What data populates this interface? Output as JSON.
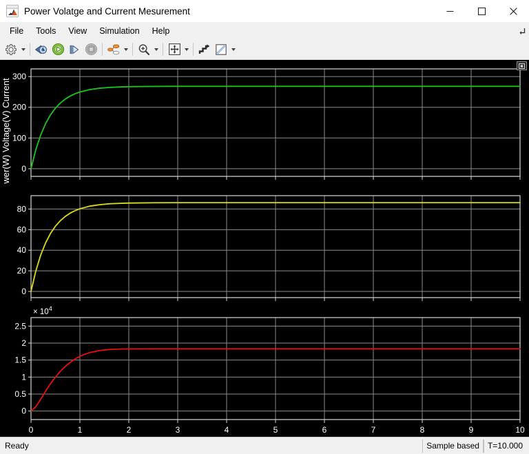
{
  "window": {
    "title": "Power Volatge and Current Mesurement",
    "app_icon": "matlab-scope-icon",
    "minimize_label": "–",
    "maximize_label": "□",
    "close_label": "✕"
  },
  "menu": {
    "items": [
      {
        "label": "File",
        "name": "menu-file"
      },
      {
        "label": "Tools",
        "name": "menu-tools"
      },
      {
        "label": "View",
        "name": "menu-view"
      },
      {
        "label": "Simulation",
        "name": "menu-simulation"
      },
      {
        "label": "Help",
        "name": "menu-help"
      }
    ],
    "overflow_icon": "menu-overflow-arrow-icon"
  },
  "toolbar": {
    "buttons": [
      {
        "name": "configuration-properties-button",
        "icon": "gear-icon",
        "has_caret": true,
        "enabled": true
      },
      {
        "name": "separator-1",
        "icon": "separator",
        "has_caret": false,
        "enabled": true
      },
      {
        "name": "run-back-to-start-button",
        "icon": "rewind-clock-icon",
        "has_caret": false,
        "enabled": true
      },
      {
        "name": "run-button",
        "icon": "play-icon",
        "has_caret": false,
        "enabled": true
      },
      {
        "name": "step-forward-button",
        "icon": "step-forward-icon",
        "has_caret": false,
        "enabled": true
      },
      {
        "name": "stop-button",
        "icon": "stop-icon",
        "has_caret": false,
        "enabled": false
      },
      {
        "name": "separator-2",
        "icon": "separator",
        "has_caret": false,
        "enabled": true
      },
      {
        "name": "signal-selector-button",
        "icon": "signal-selector-icon",
        "has_caret": true,
        "enabled": true
      },
      {
        "name": "separator-3",
        "icon": "separator",
        "has_caret": false,
        "enabled": true
      },
      {
        "name": "zoom-in-button",
        "icon": "magnifier-plus-icon",
        "has_caret": true,
        "enabled": true
      },
      {
        "name": "separator-4",
        "icon": "separator",
        "has_caret": false,
        "enabled": true
      },
      {
        "name": "autoscale-button",
        "icon": "four-arrows-icon",
        "has_caret": true,
        "enabled": true
      },
      {
        "name": "separator-5",
        "icon": "separator",
        "has_caret": false,
        "enabled": true
      },
      {
        "name": "cursor-measurements-button",
        "icon": "staircase-cursor-icon",
        "has_caret": false,
        "enabled": true
      },
      {
        "name": "annotations-button",
        "icon": "pencil-ruler-icon",
        "has_caret": true,
        "enabled": true
      }
    ]
  },
  "scope": {
    "float_button_icon": "expand-arrows-icon",
    "y_axis_label": "wer(W) Voltage(V) Current",
    "background": "#000000",
    "grid_color": "#8c8c8c",
    "axis_color": "#d9d9d9",
    "tick_text_color": "#ffffff"
  },
  "statusbar": {
    "state": "Ready",
    "frame_mode": "Sample based",
    "time": "T=10.000"
  },
  "chart_data": [
    {
      "type": "line",
      "name": "current-plot",
      "title": "",
      "xlabel": "",
      "ylabel": "Current",
      "color": "#1fbe1f",
      "xlim": [
        0,
        10
      ],
      "ylim": [
        -25,
        325
      ],
      "xticks": [
        0,
        1,
        2,
        3,
        4,
        5,
        6,
        7,
        8,
        9,
        10
      ],
      "xticklabels": [
        "",
        "",
        "",
        "",
        "",
        "",
        "",
        "",
        "",
        "",
        ""
      ],
      "yticks": [
        0,
        100,
        200,
        300
      ],
      "yticklabels": [
        "0",
        "100",
        "200",
        "300"
      ],
      "grid": true,
      "steady_state_value": 238,
      "time_constant": 0.32,
      "x": [
        0,
        0.1,
        0.2,
        0.3,
        0.4,
        0.5,
        0.6,
        0.7,
        0.8,
        0.9,
        1.0,
        1.2,
        1.4,
        1.6,
        1.8,
        2.0,
        2.5,
        3.0,
        4.0,
        5.0,
        6.0,
        7.0,
        8.0,
        9.0,
        10.0
      ],
      "y": [
        0,
        62.5,
        110.5,
        147.3,
        175.5,
        197.2,
        213.8,
        226.6,
        236.4,
        244.0,
        249.7,
        257.5,
        262.0,
        264.6,
        266.1,
        267.0,
        268.0,
        268.2,
        268.2,
        268.2,
        268.2,
        268.2,
        268.2,
        268.2,
        268.2
      ]
    },
    {
      "type": "line",
      "name": "voltage-plot",
      "title": "",
      "xlabel": "",
      "ylabel": "Voltage(V)",
      "color": "#d4d424",
      "xlim": [
        0,
        10
      ],
      "ylim": [
        -6,
        93
      ],
      "xticks": [
        0,
        1,
        2,
        3,
        4,
        5,
        6,
        7,
        8,
        9,
        10
      ],
      "xticklabels": [
        "",
        "",
        "",
        "",
        "",
        "",
        "",
        "",
        "",
        "",
        ""
      ],
      "yticks": [
        0,
        20,
        40,
        60,
        80
      ],
      "yticklabels": [
        "0",
        "20",
        "40",
        "60",
        "80"
      ],
      "grid": true,
      "steady_state_value": 76.5,
      "time_constant": 0.32,
      "x": [
        0,
        0.1,
        0.2,
        0.3,
        0.4,
        0.5,
        0.6,
        0.7,
        0.8,
        0.9,
        1.0,
        1.2,
        1.4,
        1.6,
        1.8,
        2.0,
        2.5,
        3.0,
        4.0,
        5.0,
        6.0,
        7.0,
        8.0,
        9.0,
        10.0
      ],
      "y": [
        0,
        20.1,
        35.5,
        47.3,
        56.4,
        63.4,
        68.7,
        72.8,
        76.0,
        78.4,
        80.3,
        82.8,
        84.2,
        85.1,
        85.5,
        85.8,
        86.1,
        86.2,
        86.2,
        86.2,
        86.2,
        86.2,
        86.2,
        86.2,
        86.2
      ]
    },
    {
      "type": "line",
      "name": "power-plot",
      "title": "",
      "xlabel": "",
      "ylabel": "Power(W)",
      "color": "#e01010",
      "exponent_label": "× 10",
      "exponent_superscript": "4",
      "xlim": [
        0,
        10
      ],
      "ylim": [
        -2500,
        27500
      ],
      "xticks": [
        0,
        1,
        2,
        3,
        4,
        5,
        6,
        7,
        8,
        9,
        10
      ],
      "xticklabels": [
        "0",
        "1",
        "2",
        "3",
        "4",
        "5",
        "6",
        "7",
        "8",
        "9",
        "10"
      ],
      "yticks": [
        0,
        5000,
        10000,
        15000,
        20000,
        25000
      ],
      "yticklabels": [
        "0",
        "0.5",
        "1",
        "1.5",
        "2",
        "2.5"
      ],
      "grid": true,
      "steady_state_value": 18300,
      "time_constant": 0.42,
      "x": [
        0,
        0.1,
        0.2,
        0.3,
        0.4,
        0.5,
        0.6,
        0.7,
        0.8,
        0.9,
        1.0,
        1.1,
        1.2,
        1.4,
        1.6,
        1.8,
        2.0,
        2.5,
        3.0,
        4.0,
        5.0,
        6.0,
        7.0,
        8.0,
        9.0,
        10.0
      ],
      "y": [
        0,
        1300,
        3500,
        5900,
        8100,
        10000,
        11700,
        13100,
        14300,
        15300,
        16100,
        16700,
        17200,
        17800,
        18100,
        18230,
        18290,
        18320,
        18320,
        18320,
        18320,
        18320,
        18320,
        18320,
        18320,
        18320
      ]
    }
  ]
}
